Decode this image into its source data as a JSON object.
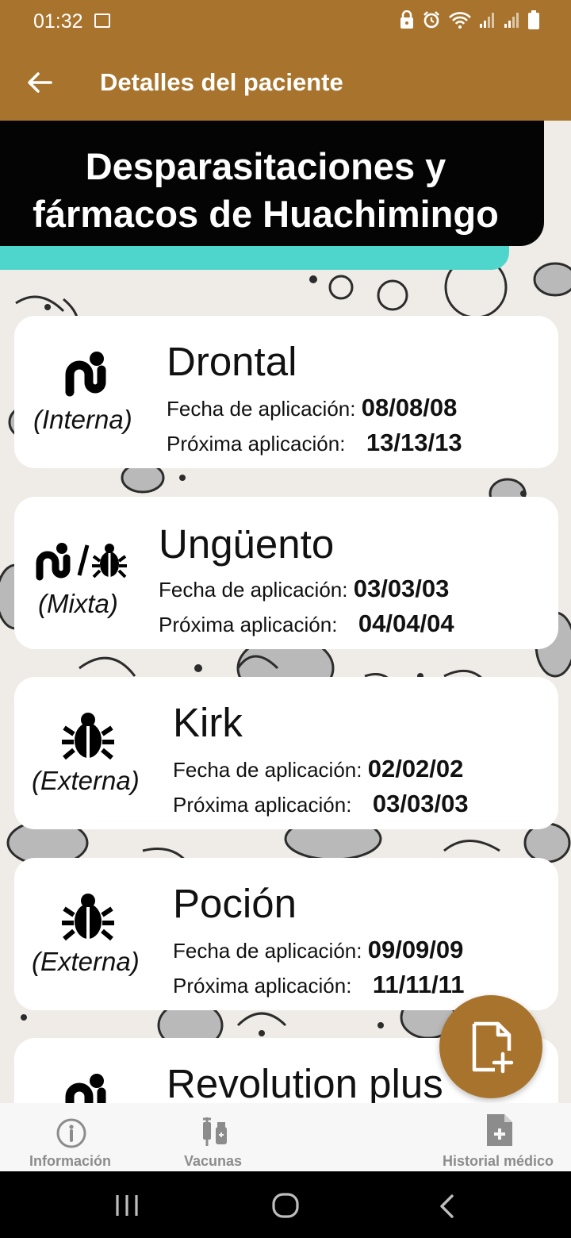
{
  "status_bar": {
    "time": "01:32"
  },
  "app_bar": {
    "title": "Detalles del paciente"
  },
  "section": {
    "title_line1": "Desparasitaciones y",
    "title_line2": "fármacos de Huachimingo"
  },
  "labels": {
    "fecha": "Fecha de aplicación:",
    "proxima": "Próxima aplicación:"
  },
  "records": [
    {
      "name": "Drontal",
      "type": "(Interna)",
      "icon": "worm-icon",
      "fecha": "08/08/08",
      "proxima": "13/13/13"
    },
    {
      "name": "Ungüento",
      "type": "(Mixta)",
      "icon": "worm-and-bug-icon",
      "fecha": "03/03/03",
      "proxima": "04/04/04"
    },
    {
      "name": "Kirk",
      "type": "(Externa)",
      "icon": "bug-icon",
      "fecha": "02/02/02",
      "proxima": "03/03/03"
    },
    {
      "name": "Poción",
      "type": "(Externa)",
      "icon": "bug-icon",
      "fecha": "09/09/09",
      "proxima": "11/11/11"
    },
    {
      "name": "Revolution plus",
      "icon": "worm-icon"
    }
  ],
  "fab": {
    "icon": "add-document-icon"
  },
  "bottom_nav": [
    {
      "label": "Información",
      "icon": "info-icon"
    },
    {
      "label": "Vacunas",
      "icon": "syringe-vial-icon"
    },
    {
      "label": "Historial médico",
      "icon": "medical-file-icon"
    }
  ],
  "colors": {
    "brand": "#a8742d",
    "header_bg": "#040404",
    "accent": "#4fd6cc"
  }
}
